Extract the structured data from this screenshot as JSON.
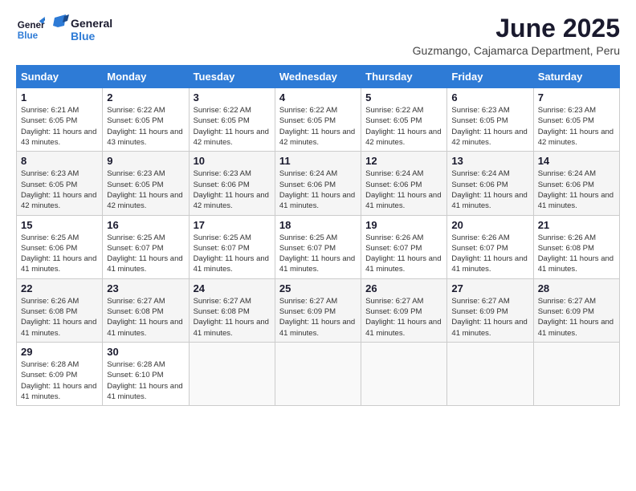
{
  "header": {
    "logo_general": "General",
    "logo_blue": "Blue",
    "month_year": "June 2025",
    "location": "Guzmango, Cajamarca Department, Peru"
  },
  "calendar": {
    "days_of_week": [
      "Sunday",
      "Monday",
      "Tuesday",
      "Wednesday",
      "Thursday",
      "Friday",
      "Saturday"
    ],
    "weeks": [
      [
        null,
        {
          "day": 2,
          "sunrise": "Sunrise: 6:22 AM",
          "sunset": "Sunset: 6:05 PM",
          "daylight": "Daylight: 11 hours and 43 minutes."
        },
        {
          "day": 3,
          "sunrise": "Sunrise: 6:22 AM",
          "sunset": "Sunset: 6:05 PM",
          "daylight": "Daylight: 11 hours and 42 minutes."
        },
        {
          "day": 4,
          "sunrise": "Sunrise: 6:22 AM",
          "sunset": "Sunset: 6:05 PM",
          "daylight": "Daylight: 11 hours and 42 minutes."
        },
        {
          "day": 5,
          "sunrise": "Sunrise: 6:22 AM",
          "sunset": "Sunset: 6:05 PM",
          "daylight": "Daylight: 11 hours and 42 minutes."
        },
        {
          "day": 6,
          "sunrise": "Sunrise: 6:23 AM",
          "sunset": "Sunset: 6:05 PM",
          "daylight": "Daylight: 11 hours and 42 minutes."
        },
        {
          "day": 7,
          "sunrise": "Sunrise: 6:23 AM",
          "sunset": "Sunset: 6:05 PM",
          "daylight": "Daylight: 11 hours and 42 minutes."
        }
      ],
      [
        {
          "day": 1,
          "sunrise": "Sunrise: 6:21 AM",
          "sunset": "Sunset: 6:05 PM",
          "daylight": "Daylight: 11 hours and 43 minutes."
        },
        null,
        null,
        null,
        null,
        null,
        null
      ],
      [
        {
          "day": 8,
          "sunrise": "Sunrise: 6:23 AM",
          "sunset": "Sunset: 6:05 PM",
          "daylight": "Daylight: 11 hours and 42 minutes."
        },
        {
          "day": 9,
          "sunrise": "Sunrise: 6:23 AM",
          "sunset": "Sunset: 6:05 PM",
          "daylight": "Daylight: 11 hours and 42 minutes."
        },
        {
          "day": 10,
          "sunrise": "Sunrise: 6:23 AM",
          "sunset": "Sunset: 6:06 PM",
          "daylight": "Daylight: 11 hours and 42 minutes."
        },
        {
          "day": 11,
          "sunrise": "Sunrise: 6:24 AM",
          "sunset": "Sunset: 6:06 PM",
          "daylight": "Daylight: 11 hours and 41 minutes."
        },
        {
          "day": 12,
          "sunrise": "Sunrise: 6:24 AM",
          "sunset": "Sunset: 6:06 PM",
          "daylight": "Daylight: 11 hours and 41 minutes."
        },
        {
          "day": 13,
          "sunrise": "Sunrise: 6:24 AM",
          "sunset": "Sunset: 6:06 PM",
          "daylight": "Daylight: 11 hours and 41 minutes."
        },
        {
          "day": 14,
          "sunrise": "Sunrise: 6:24 AM",
          "sunset": "Sunset: 6:06 PM",
          "daylight": "Daylight: 11 hours and 41 minutes."
        }
      ],
      [
        {
          "day": 15,
          "sunrise": "Sunrise: 6:25 AM",
          "sunset": "Sunset: 6:06 PM",
          "daylight": "Daylight: 11 hours and 41 minutes."
        },
        {
          "day": 16,
          "sunrise": "Sunrise: 6:25 AM",
          "sunset": "Sunset: 6:07 PM",
          "daylight": "Daylight: 11 hours and 41 minutes."
        },
        {
          "day": 17,
          "sunrise": "Sunrise: 6:25 AM",
          "sunset": "Sunset: 6:07 PM",
          "daylight": "Daylight: 11 hours and 41 minutes."
        },
        {
          "day": 18,
          "sunrise": "Sunrise: 6:25 AM",
          "sunset": "Sunset: 6:07 PM",
          "daylight": "Daylight: 11 hours and 41 minutes."
        },
        {
          "day": 19,
          "sunrise": "Sunrise: 6:26 AM",
          "sunset": "Sunset: 6:07 PM",
          "daylight": "Daylight: 11 hours and 41 minutes."
        },
        {
          "day": 20,
          "sunrise": "Sunrise: 6:26 AM",
          "sunset": "Sunset: 6:07 PM",
          "daylight": "Daylight: 11 hours and 41 minutes."
        },
        {
          "day": 21,
          "sunrise": "Sunrise: 6:26 AM",
          "sunset": "Sunset: 6:08 PM",
          "daylight": "Daylight: 11 hours and 41 minutes."
        }
      ],
      [
        {
          "day": 22,
          "sunrise": "Sunrise: 6:26 AM",
          "sunset": "Sunset: 6:08 PM",
          "daylight": "Daylight: 11 hours and 41 minutes."
        },
        {
          "day": 23,
          "sunrise": "Sunrise: 6:27 AM",
          "sunset": "Sunset: 6:08 PM",
          "daylight": "Daylight: 11 hours and 41 minutes."
        },
        {
          "day": 24,
          "sunrise": "Sunrise: 6:27 AM",
          "sunset": "Sunset: 6:08 PM",
          "daylight": "Daylight: 11 hours and 41 minutes."
        },
        {
          "day": 25,
          "sunrise": "Sunrise: 6:27 AM",
          "sunset": "Sunset: 6:09 PM",
          "daylight": "Daylight: 11 hours and 41 minutes."
        },
        {
          "day": 26,
          "sunrise": "Sunrise: 6:27 AM",
          "sunset": "Sunset: 6:09 PM",
          "daylight": "Daylight: 11 hours and 41 minutes."
        },
        {
          "day": 27,
          "sunrise": "Sunrise: 6:27 AM",
          "sunset": "Sunset: 6:09 PM",
          "daylight": "Daylight: 11 hours and 41 minutes."
        },
        {
          "day": 28,
          "sunrise": "Sunrise: 6:27 AM",
          "sunset": "Sunset: 6:09 PM",
          "daylight": "Daylight: 11 hours and 41 minutes."
        }
      ],
      [
        {
          "day": 29,
          "sunrise": "Sunrise: 6:28 AM",
          "sunset": "Sunset: 6:09 PM",
          "daylight": "Daylight: 11 hours and 41 minutes."
        },
        {
          "day": 30,
          "sunrise": "Sunrise: 6:28 AM",
          "sunset": "Sunset: 6:10 PM",
          "daylight": "Daylight: 11 hours and 41 minutes."
        },
        null,
        null,
        null,
        null,
        null
      ]
    ]
  }
}
